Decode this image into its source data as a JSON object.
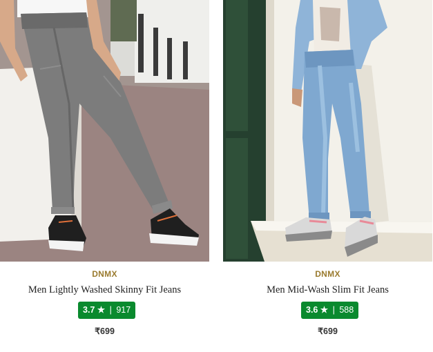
{
  "products": [
    {
      "brand": "DNMX",
      "title": "Men Lightly Washed Skinny Fit Jeans",
      "rating": "3.7",
      "star": "★",
      "separator": "|",
      "rating_count": "917",
      "price": "₹699",
      "image": "grey-skinny-jeans-model-photo",
      "rating_color": "#0a8a2e"
    },
    {
      "brand": "DNMX",
      "title": "Men Mid-Wash Slim Fit Jeans",
      "rating": "3.6",
      "star": "★",
      "separator": "|",
      "rating_count": "588",
      "price": "₹699",
      "image": "blue-slim-jeans-model-photo",
      "rating_color": "#0a8a2e"
    }
  ]
}
